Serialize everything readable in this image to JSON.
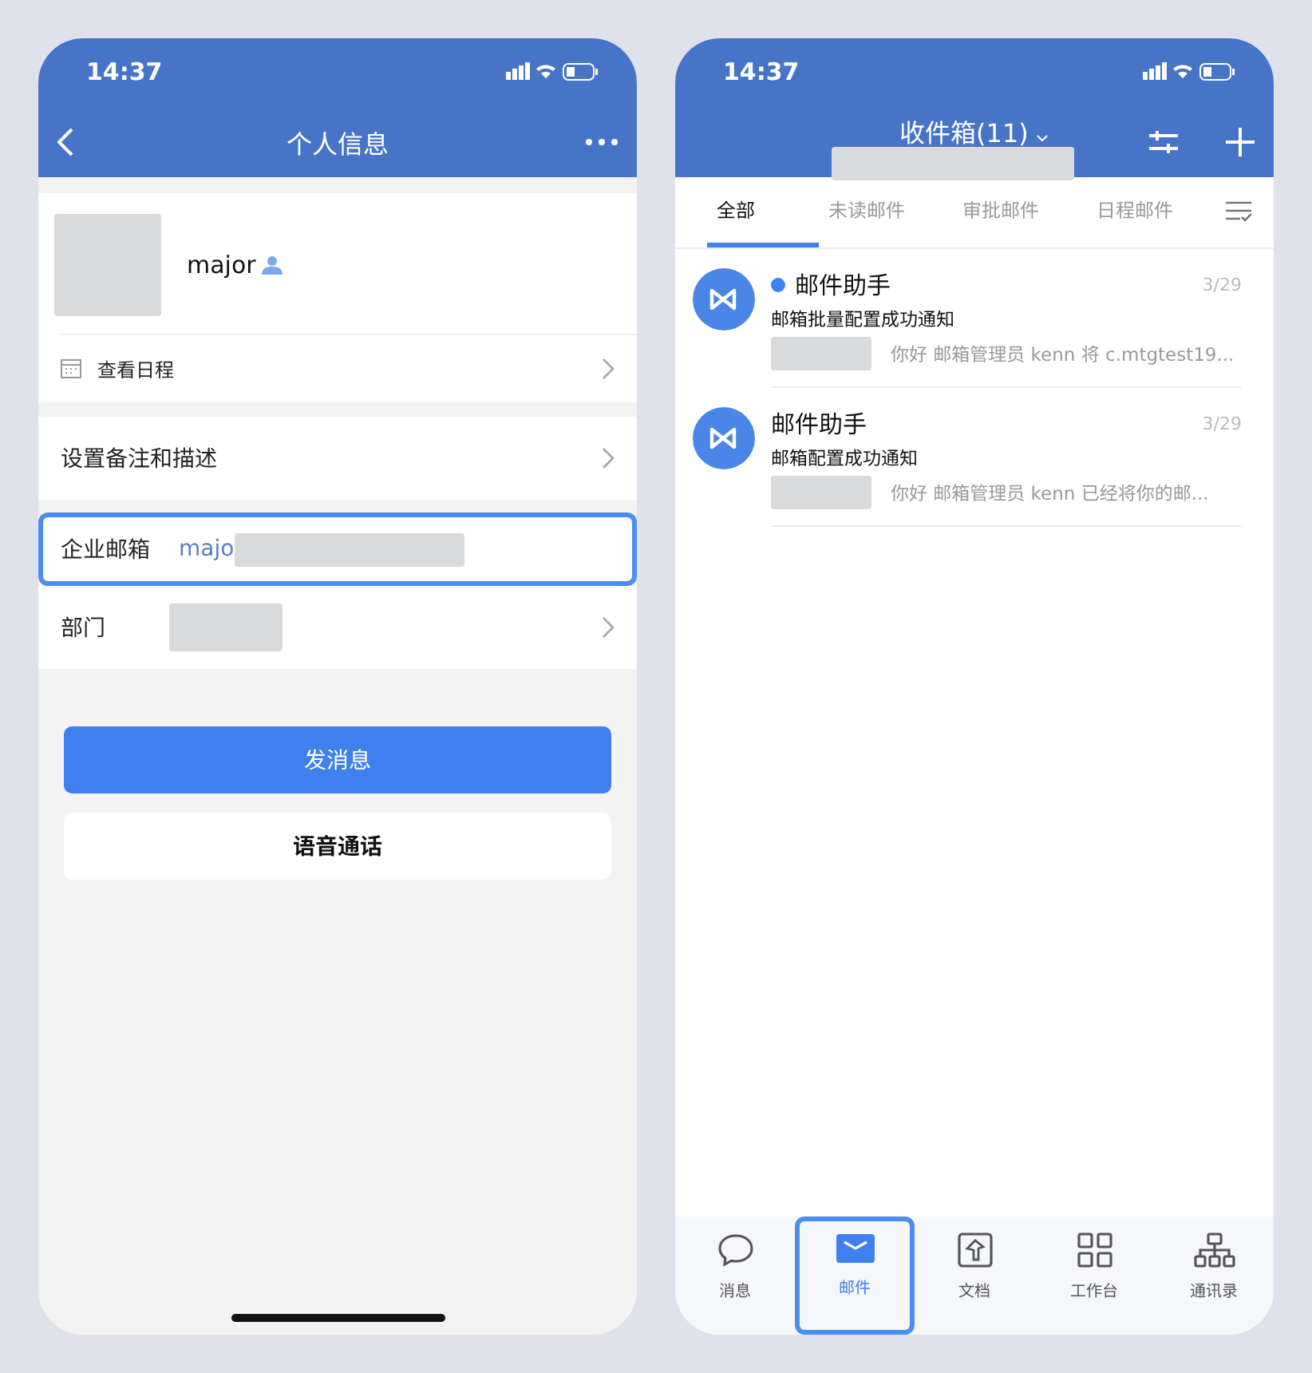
{
  "left_phone": {
    "status_time": "14:37",
    "title": "个人信息",
    "profile": {
      "name": "major"
    },
    "schedule_link": "查看日程",
    "rows": [
      {
        "kind": "link",
        "label": "设置备注和描述",
        "highlighted": false
      },
      {
        "kind": "email",
        "label": "企业邮箱",
        "value": "majo",
        "highlighted": true
      },
      {
        "kind": "department",
        "label": "部门",
        "highlighted": false
      }
    ],
    "buttons": [
      {
        "kind": "primary",
        "label": "发消息"
      },
      {
        "kind": "secondary",
        "label": "语音通话"
      }
    ]
  },
  "right_phone": {
    "status_time": "14:37",
    "title": "收件箱(11)",
    "tabs": [
      {
        "label": "全部",
        "selected": true
      },
      {
        "label": "未读邮件",
        "selected": false
      },
      {
        "label": "审批邮件",
        "selected": false
      },
      {
        "label": "日程邮件",
        "selected": false
      }
    ],
    "messages": [
      {
        "sender": "邮件助手",
        "unread": true,
        "date": "3/29",
        "subject": "邮箱批量配置成功通知",
        "preview": "你好 邮箱管理员 kenn 将 c.mtgtest19..."
      },
      {
        "sender": "邮件助手",
        "unread": false,
        "date": "3/29",
        "subject": "邮箱配置成功通知",
        "preview": "你好 邮箱管理员 kenn 已经将你的邮..."
      }
    ],
    "nav": [
      {
        "kind": "chat",
        "label": "消息",
        "selected": false,
        "highlighted": false
      },
      {
        "kind": "mail",
        "label": "邮件",
        "selected": true,
        "highlighted": true
      },
      {
        "kind": "docs",
        "label": "文档",
        "selected": false,
        "highlighted": false
      },
      {
        "kind": "workbench",
        "label": "工作台",
        "selected": false,
        "highlighted": false
      },
      {
        "kind": "contacts",
        "label": "通讯录",
        "selected": false,
        "highlighted": false
      }
    ]
  }
}
